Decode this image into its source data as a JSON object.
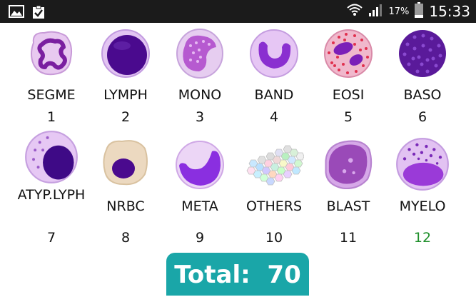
{
  "status_bar": {
    "battery": "17%",
    "time": "15:33"
  },
  "cells": [
    {
      "label": "SEGME",
      "count": "1",
      "selected": false
    },
    {
      "label": "LYMPH",
      "count": "2",
      "selected": false
    },
    {
      "label": "MONO",
      "count": "3",
      "selected": false
    },
    {
      "label": "BAND",
      "count": "4",
      "selected": false
    },
    {
      "label": "EOSI",
      "count": "5",
      "selected": false
    },
    {
      "label": "BASO",
      "count": "6",
      "selected": false
    },
    {
      "label": "ATYP.LYPH",
      "count": "7",
      "selected": false
    },
    {
      "label": "NRBC",
      "count": "8",
      "selected": false
    },
    {
      "label": "META",
      "count": "9",
      "selected": false
    },
    {
      "label": "OTHERS",
      "count": "10",
      "selected": false
    },
    {
      "label": "BLAST",
      "count": "11",
      "selected": false
    },
    {
      "label": "MYELO",
      "count": "12",
      "selected": true
    }
  ],
  "total": {
    "label": "Total:",
    "value": "70"
  },
  "colors": {
    "status_bar": "#1b1b1b",
    "total_bg": "#1aa6a8",
    "selected_number": "#1e8f2a"
  }
}
